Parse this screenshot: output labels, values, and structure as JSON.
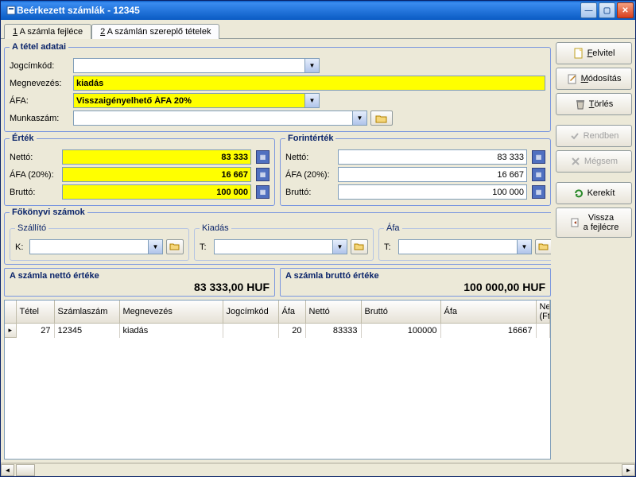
{
  "window": {
    "title": "Beérkezett számlák - 12345"
  },
  "tabs": {
    "tab1_prefix": "1",
    "tab1_label": " A számla fejléce",
    "tab2_prefix": "2",
    "tab2_label": " A számlán szereplő tételek"
  },
  "tetel_adatai": {
    "legend": "A tétel adatai",
    "jogcimkod_label": "Jogcímkód:",
    "jogcimkod_value": "",
    "megnevezes_label": "Megnevezés:",
    "megnevezes_value": "kiadás",
    "afa_label": "ÁFA:",
    "afa_value": "Visszaigényelhető ÁFA 20%",
    "munkaszam_label": "Munkaszám:",
    "munkaszam_value": ""
  },
  "ertek": {
    "legend": "Érték",
    "netto_label": "Nettó:",
    "netto_value": "83 333",
    "afa_label": "ÁFA (20%):",
    "afa_value": "16 667",
    "brutto_label": "Bruttó:",
    "brutto_value": "100 000"
  },
  "forintertek": {
    "legend": "Forintérték",
    "netto_label": "Nettó:",
    "netto_value": "83 333",
    "afa_label": "ÁFA (20%):",
    "afa_value": "16 667",
    "brutto_label": "Bruttó:",
    "brutto_value": "100 000"
  },
  "fokonyvi": {
    "legend": "Főkönyvi számok",
    "szallito_legend": "Szállító",
    "szallito_label": "K:",
    "szallito_value": "",
    "kiadas_legend": "Kiadás",
    "kiadas_label": "T:",
    "kiadas_value": "",
    "afa_legend": "Áfa",
    "afa_label": "T:",
    "afa_value": ""
  },
  "summary": {
    "netto_label": "A számla nettó értéke",
    "netto_value": "83 333,00  HUF",
    "brutto_label": "A számla bruttó értéke",
    "brutto_value": "100 000,00  HUF"
  },
  "grid": {
    "headers": [
      "Tétel",
      "Számlaszám",
      "Megnevezés",
      "Jogcímkód",
      "Áfa",
      "Nettó",
      "Bruttó",
      "Áfa",
      "Nettó (Ft)"
    ],
    "rows": [
      {
        "tetel": "27",
        "szamlaszam": "12345",
        "megnevezes": "kiadás",
        "jogcimkod": "",
        "afa_perc": "20",
        "netto": "83333",
        "brutto": "100000",
        "afa": "16667",
        "netto_ft": ""
      }
    ]
  },
  "buttons": {
    "felvitel": "Felvitel",
    "modositas": "Módosítás",
    "torles": "Törlés",
    "rendben": "Rendben",
    "megsem": "Mégsem",
    "kerekit": "Kerekít",
    "vissza_l1": "Vissza",
    "vissza_l2": "a fejlécre"
  }
}
